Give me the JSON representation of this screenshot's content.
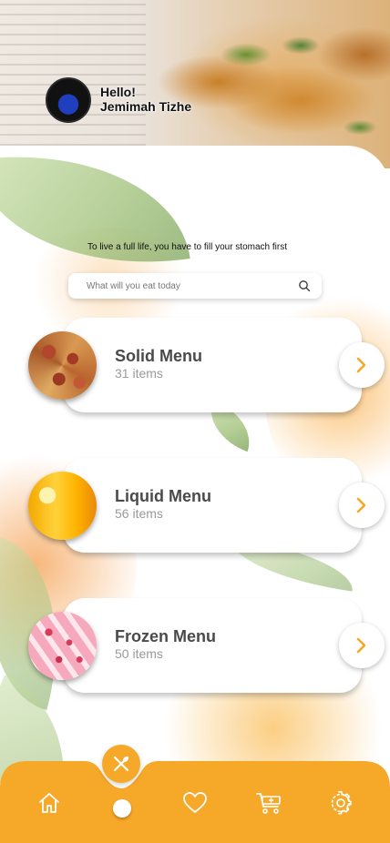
{
  "user": {
    "greeting": "Hello!",
    "name": "Jemimah Tizhe"
  },
  "tagline": "To live a full life, you have to fill your stomach first",
  "search": {
    "placeholder": "What will you eat today",
    "icon": "search-icon"
  },
  "menus": [
    {
      "title": "Solid Menu",
      "count": "31 items",
      "icon": "chevron-right-icon"
    },
    {
      "title": "Liquid Menu",
      "count": "56 items",
      "icon": "chevron-right-icon"
    },
    {
      "title": "Frozen Menu",
      "count": "50 items",
      "icon": "chevron-right-icon"
    }
  ],
  "nav": {
    "items": [
      "home-icon",
      "fork-knife-icon",
      "heart-icon",
      "cart-icon",
      "gear-icon"
    ],
    "active": "fork-knife-icon"
  },
  "colors": {
    "accent": "#F6A829",
    "card_text": "#4A4A4A",
    "muted_text": "#9A9A9A"
  }
}
